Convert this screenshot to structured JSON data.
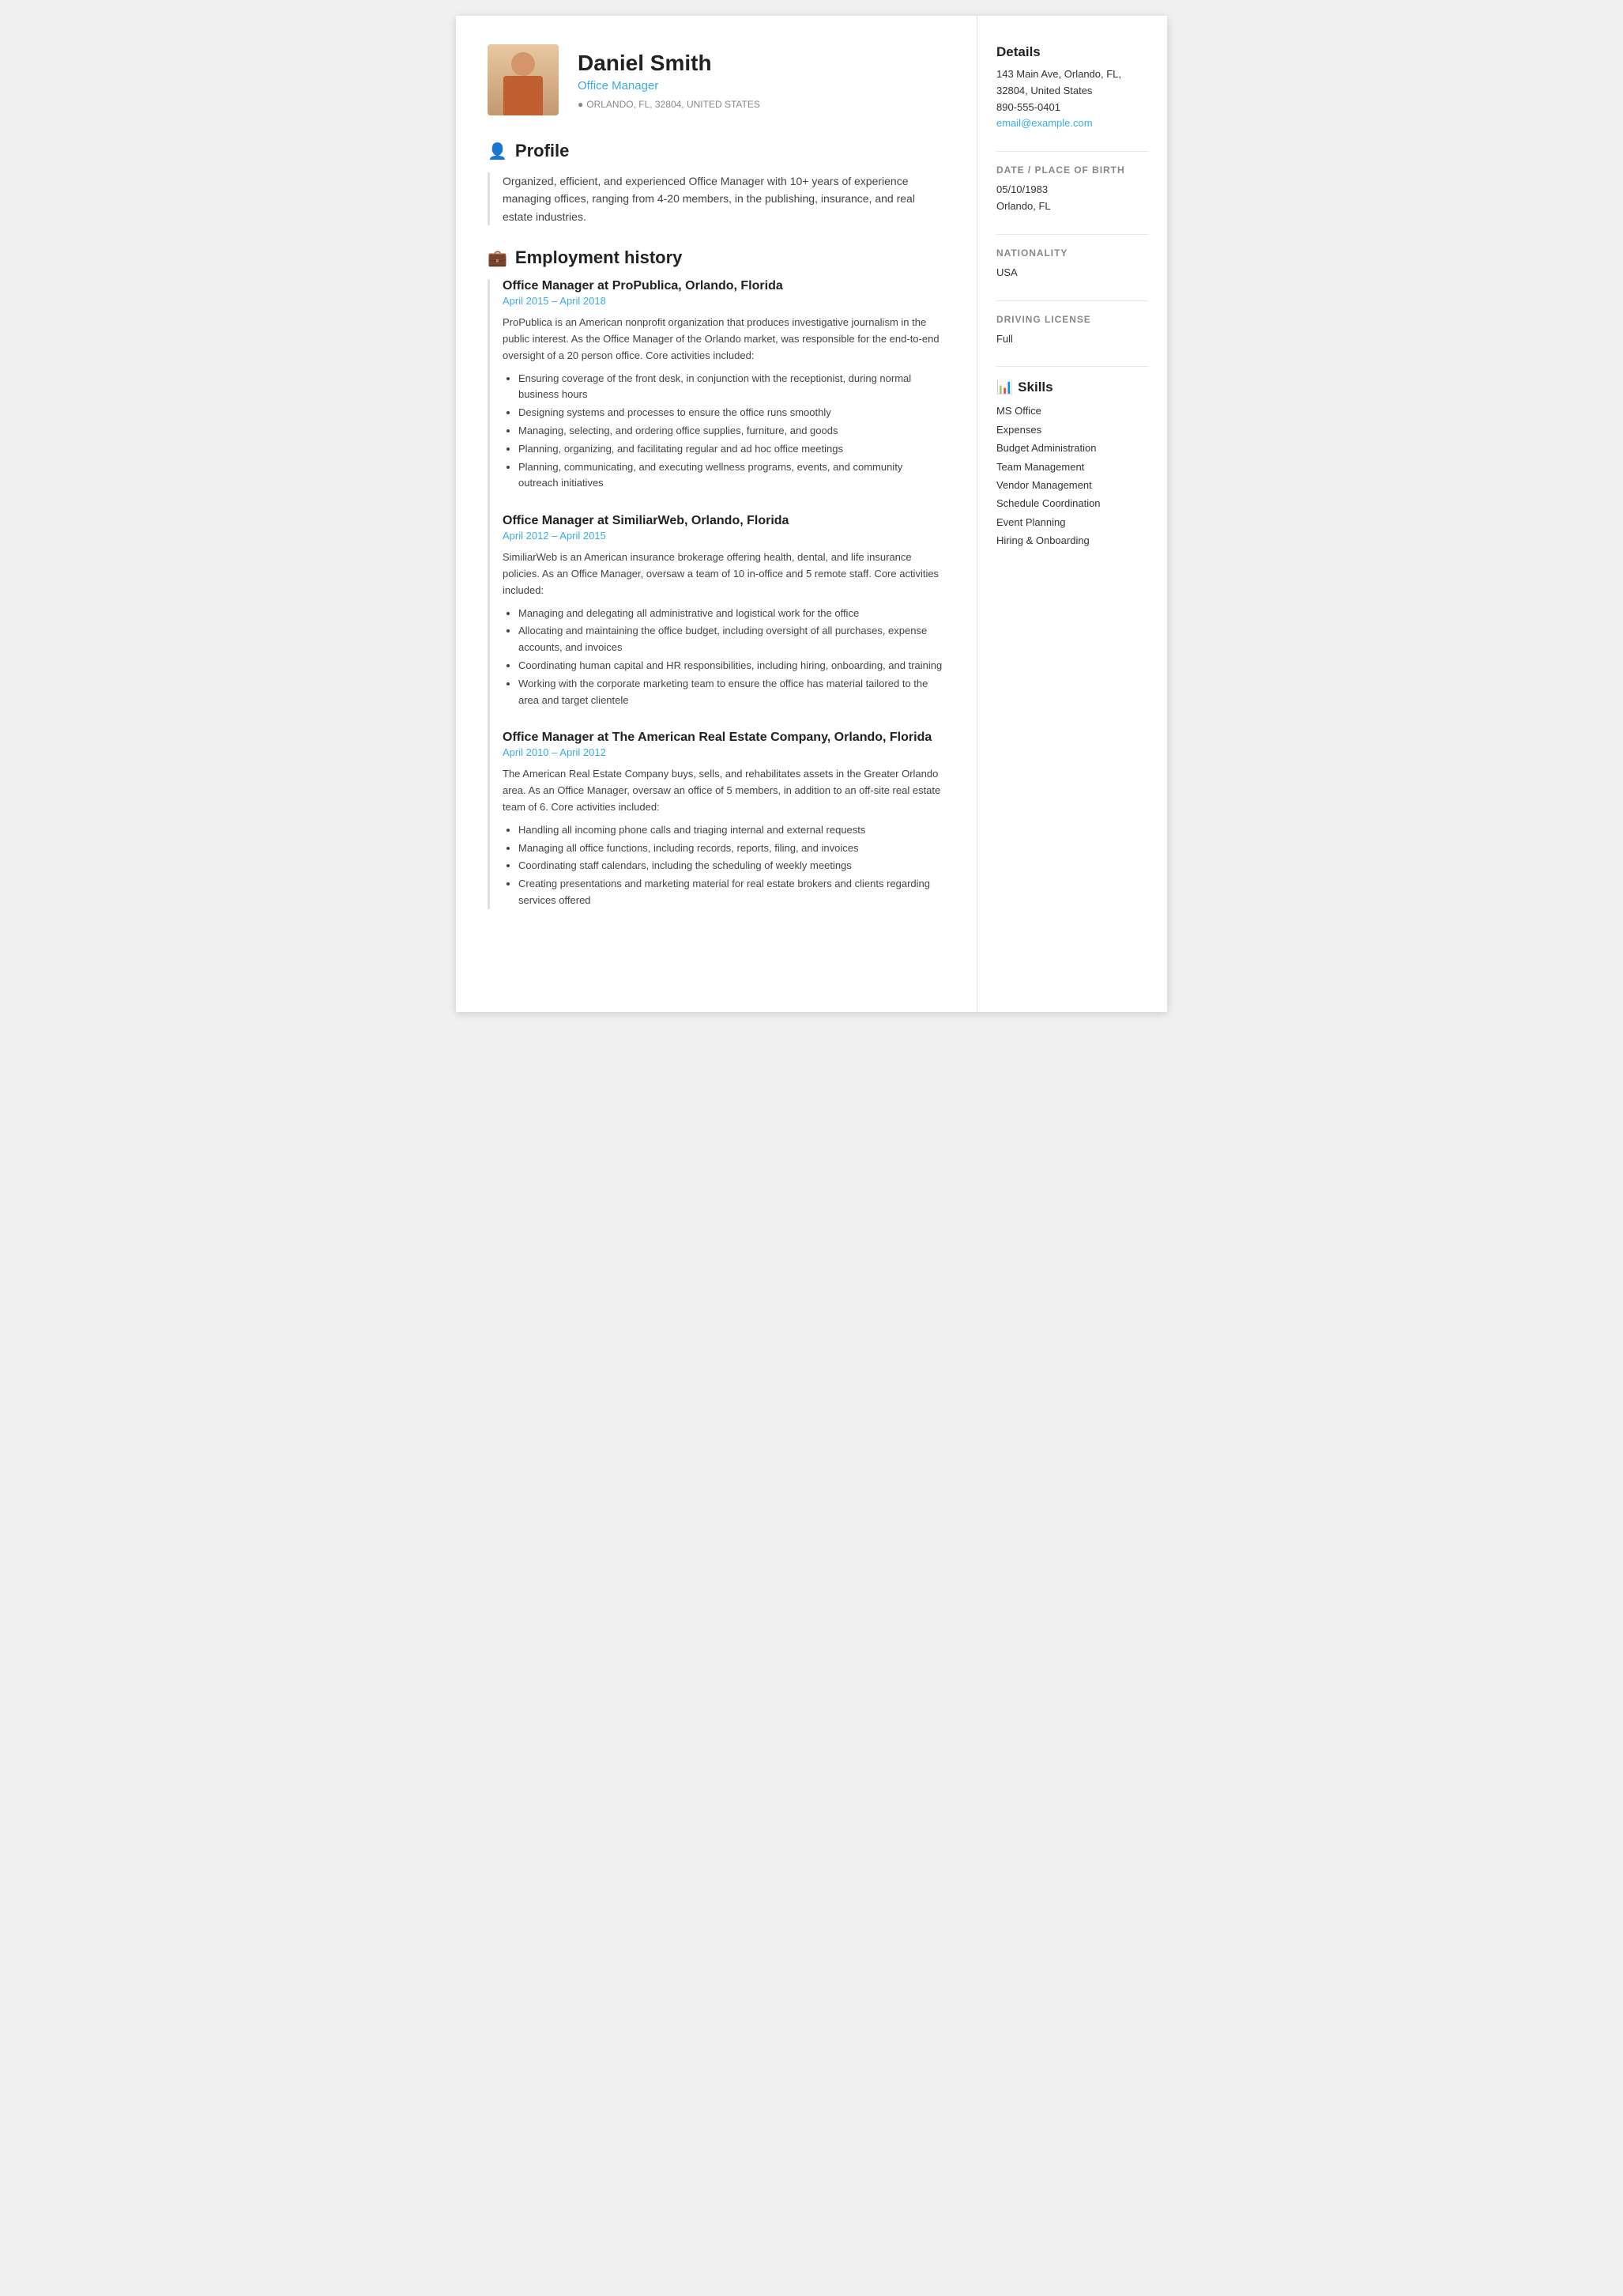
{
  "header": {
    "name": "Daniel Smith",
    "job_title": "Office Manager",
    "location": "ORLANDO, FL, 32804, UNITED STATES"
  },
  "profile": {
    "section_title": "Profile",
    "text": "Organized, efficient, and experienced Office Manager with 10+ years of experience managing offices, ranging from 4-20 members, in the publishing, insurance, and real estate industries."
  },
  "employment": {
    "section_title": "Employment history",
    "jobs": [
      {
        "title": "Office Manager at ProPublica, Orlando, Florida",
        "dates": "April 2015  –  April 2018",
        "description": "ProPublica is an American nonprofit organization that produces investigative journalism in the public interest. As the Office Manager of the Orlando market, was responsible for the end-to-end oversight of a 20 person office. Core activities included:",
        "bullets": [
          "Ensuring coverage of the front desk, in conjunction with the receptionist, during normal business hours",
          "Designing systems and processes to ensure the office runs smoothly",
          "Managing, selecting, and ordering office supplies, furniture, and goods",
          "Planning, organizing, and facilitating regular and ad hoc office meetings",
          "Planning, communicating, and executing wellness programs, events, and community outreach initiatives"
        ]
      },
      {
        "title": "Office Manager at SimiliarWeb, Orlando, Florida",
        "dates": "April 2012  –  April 2015",
        "description": "SimiliarWeb is an American insurance brokerage offering health, dental, and life insurance policies. As an Office Manager, oversaw a team of 10 in-office and 5 remote staff. Core activities included:",
        "bullets": [
          "Managing and delegating all administrative and logistical work for the office",
          "Allocating and maintaining the office budget, including oversight of all purchases, expense accounts, and invoices",
          "Coordinating human capital and HR responsibilities, including hiring, onboarding, and training",
          "Working with the corporate marketing team to ensure the office has material tailored to the area and target clientele"
        ]
      },
      {
        "title": "Office Manager at The American Real Estate Company, Orlando, Florida",
        "dates": "April 2010  –  April 2012",
        "description": "The American Real Estate Company buys, sells, and rehabilitates assets in the Greater Orlando area. As an Office Manager, oversaw an office of 5 members, in addition to an off-site real estate team of 6. Core activities included:",
        "bullets": [
          "Handling all incoming phone calls and triaging internal and external requests",
          "Managing all office functions, including records, reports, filing, and invoices",
          "Coordinating staff calendars, including the scheduling of weekly meetings",
          "Creating presentations and marketing material for real estate brokers and clients regarding services offered"
        ]
      }
    ]
  },
  "sidebar": {
    "details_title": "Details",
    "address": "143 Main Ave, Orlando, FL, 32804, United States",
    "phone": "890-555-0401",
    "email": "email@example.com",
    "dob_label": "DATE / PLACE OF BIRTH",
    "dob_value": "05/10/1983",
    "dob_place": "Orlando, FL",
    "nationality_label": "NATIONALITY",
    "nationality_value": "USA",
    "driving_label": "DRIVING LICENSE",
    "driving_value": "Full",
    "skills_title": "Skills",
    "skills": [
      "MS Office",
      "Expenses",
      "Budget Administration",
      "Team Management",
      "Vendor Management",
      "Schedule Coordination",
      "Event Planning",
      "Hiring & Onboarding"
    ]
  }
}
